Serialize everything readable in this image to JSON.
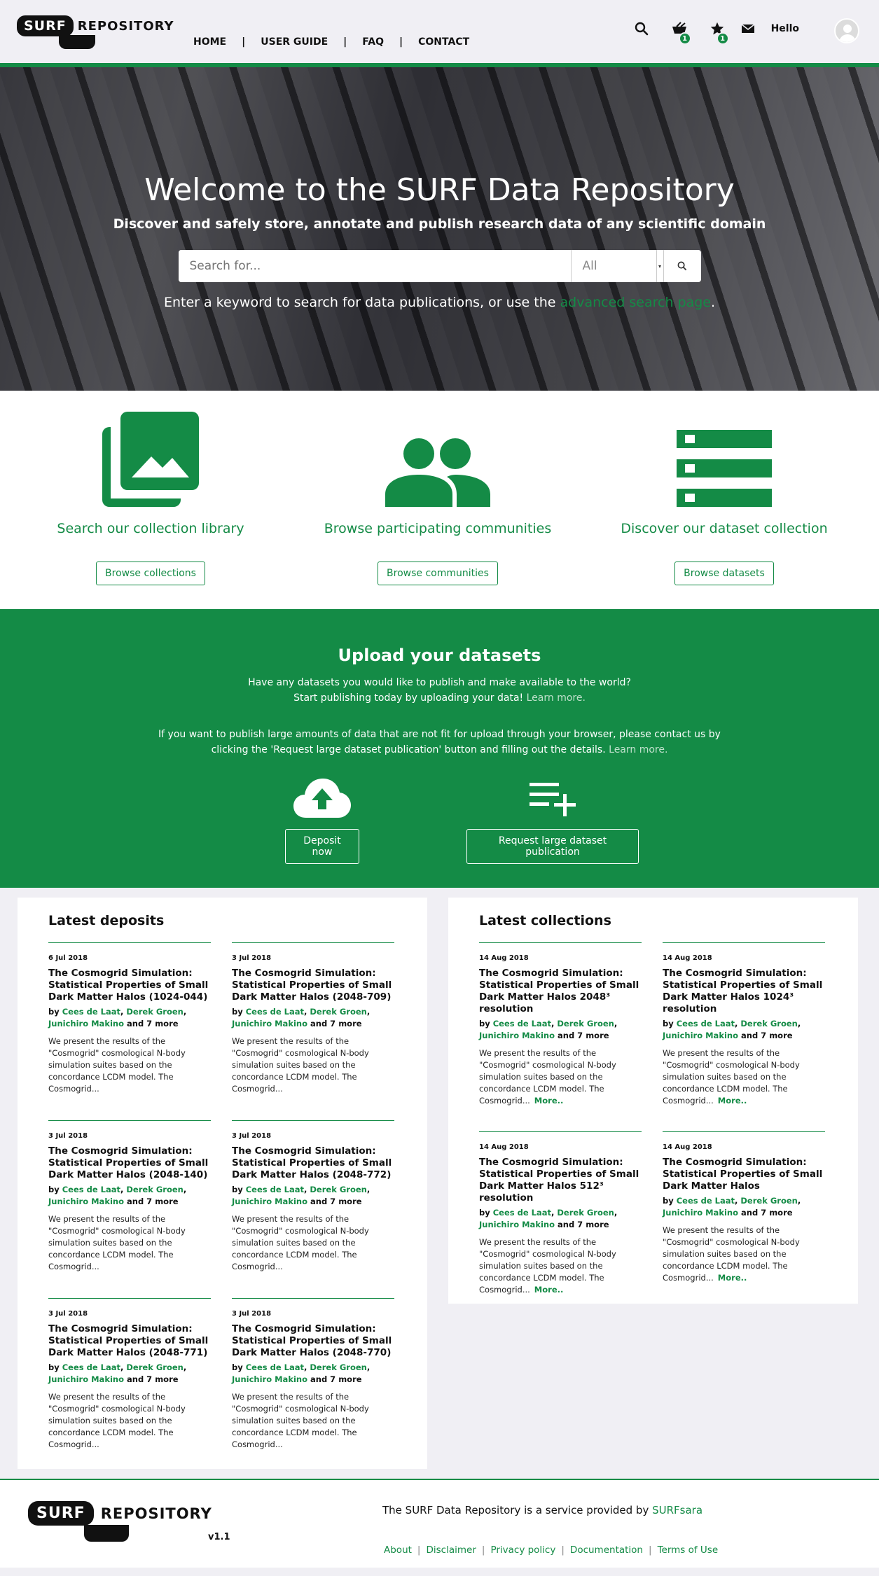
{
  "header": {
    "logo_left": "SURF",
    "logo_right": "REPOSITORY",
    "nav": [
      "HOME",
      "USER GUIDE",
      "FAQ",
      "CONTACT"
    ],
    "nav_separator": "|",
    "cart_count": "1",
    "favorites_count": "1",
    "greeting": "Hello"
  },
  "hero": {
    "title": "Welcome to the SURF Data Repository",
    "subtitle": "Discover and safely store, annotate and publish research data of any scientific domain",
    "search_placeholder": "Search for...",
    "search_scope": "All",
    "hint_prefix": "Enter a keyword to search for data publications, or use the ",
    "hint_link": "advanced search page",
    "hint_suffix": "."
  },
  "features": [
    {
      "icon": "image-collection-icon",
      "title": "Search our collection library",
      "button": "Browse collections"
    },
    {
      "icon": "people-icon",
      "title": "Browse participating communities",
      "button": "Browse communities"
    },
    {
      "icon": "dataset-list-icon",
      "title": "Discover our dataset collection",
      "button": "Browse datasets"
    }
  ],
  "upload": {
    "title": "Upload your datasets",
    "line1": "Have any datasets you would like to publish and make available to the world?",
    "line2": "Start publishing today by uploading your data!",
    "learn_more": "Learn more.",
    "large_line1": "If you want to publish large amounts of data that are not fit for upload through your browser, please contact us by",
    "large_line2": "clicking the 'Request large dataset publication' button and filling out the details.",
    "deposit_button": "Deposit now",
    "request_button": "Request large dataset publication"
  },
  "latest_deposits": {
    "heading": "Latest deposits",
    "items": [
      {
        "date": "6 Jul 2018",
        "title": "The Cosmogrid Simulation: Statistical Properties of Small Dark Matter Halos (1024-044)"
      },
      {
        "date": "3 Jul 2018",
        "title": "The Cosmogrid Simulation: Statistical Properties of Small Dark Matter Halos (2048-709)"
      },
      {
        "date": "3 Jul 2018",
        "title": "The Cosmogrid Simulation: Statistical Properties of Small Dark Matter Halos (2048-140)"
      },
      {
        "date": "3 Jul 2018",
        "title": "The Cosmogrid Simulation: Statistical Properties of Small Dark Matter Halos (2048-772)"
      },
      {
        "date": "3 Jul 2018",
        "title": "The Cosmogrid Simulation: Statistical Properties of Small Dark Matter Halos (2048-771)"
      },
      {
        "date": "3 Jul 2018",
        "title": "The Cosmogrid Simulation: Statistical Properties of Small Dark Matter Halos (2048-770)"
      }
    ]
  },
  "latest_collections": {
    "heading": "Latest collections",
    "items": [
      {
        "date": "14 Aug 2018",
        "title": "The Cosmogrid Simulation: Statistical Properties of Small Dark Matter Halos 2048³ resolution"
      },
      {
        "date": "14 Aug 2018",
        "title": "The Cosmogrid Simulation: Statistical Properties of Small Dark Matter Halos 1024³ resolution"
      },
      {
        "date": "14 Aug 2018",
        "title": "The Cosmogrid Simulation: Statistical Properties of Small Dark Matter Halos 512³ resolution"
      },
      {
        "date": "14 Aug 2018",
        "title": "The Cosmogrid Simulation: Statistical Properties of Small Dark Matter Halos"
      }
    ]
  },
  "card_common": {
    "by": "by ",
    "author1": "Cees de Laat",
    "author2": "Derek Groen",
    "author3": "Junichiro Makino",
    "more_authors": " and 7 more",
    "description": "We present the results of the \"Cosmogrid\" cosmological N-body simulation suites based on the concordance LCDM model. The Cosmogrid...",
    "more_link": "More.."
  },
  "footer": {
    "logo_left": "SURF",
    "logo_right": "REPOSITORY",
    "version": "v1.1",
    "service_text": "The SURF Data Repository is a service provided by ",
    "service_link": "SURFsara",
    "links": [
      "About",
      "Disclaimer",
      "Privacy policy",
      "Documentation",
      "Terms of Use"
    ]
  },
  "colors": {
    "brand_green": "#148b46",
    "page_bg": "#f0eff4"
  }
}
